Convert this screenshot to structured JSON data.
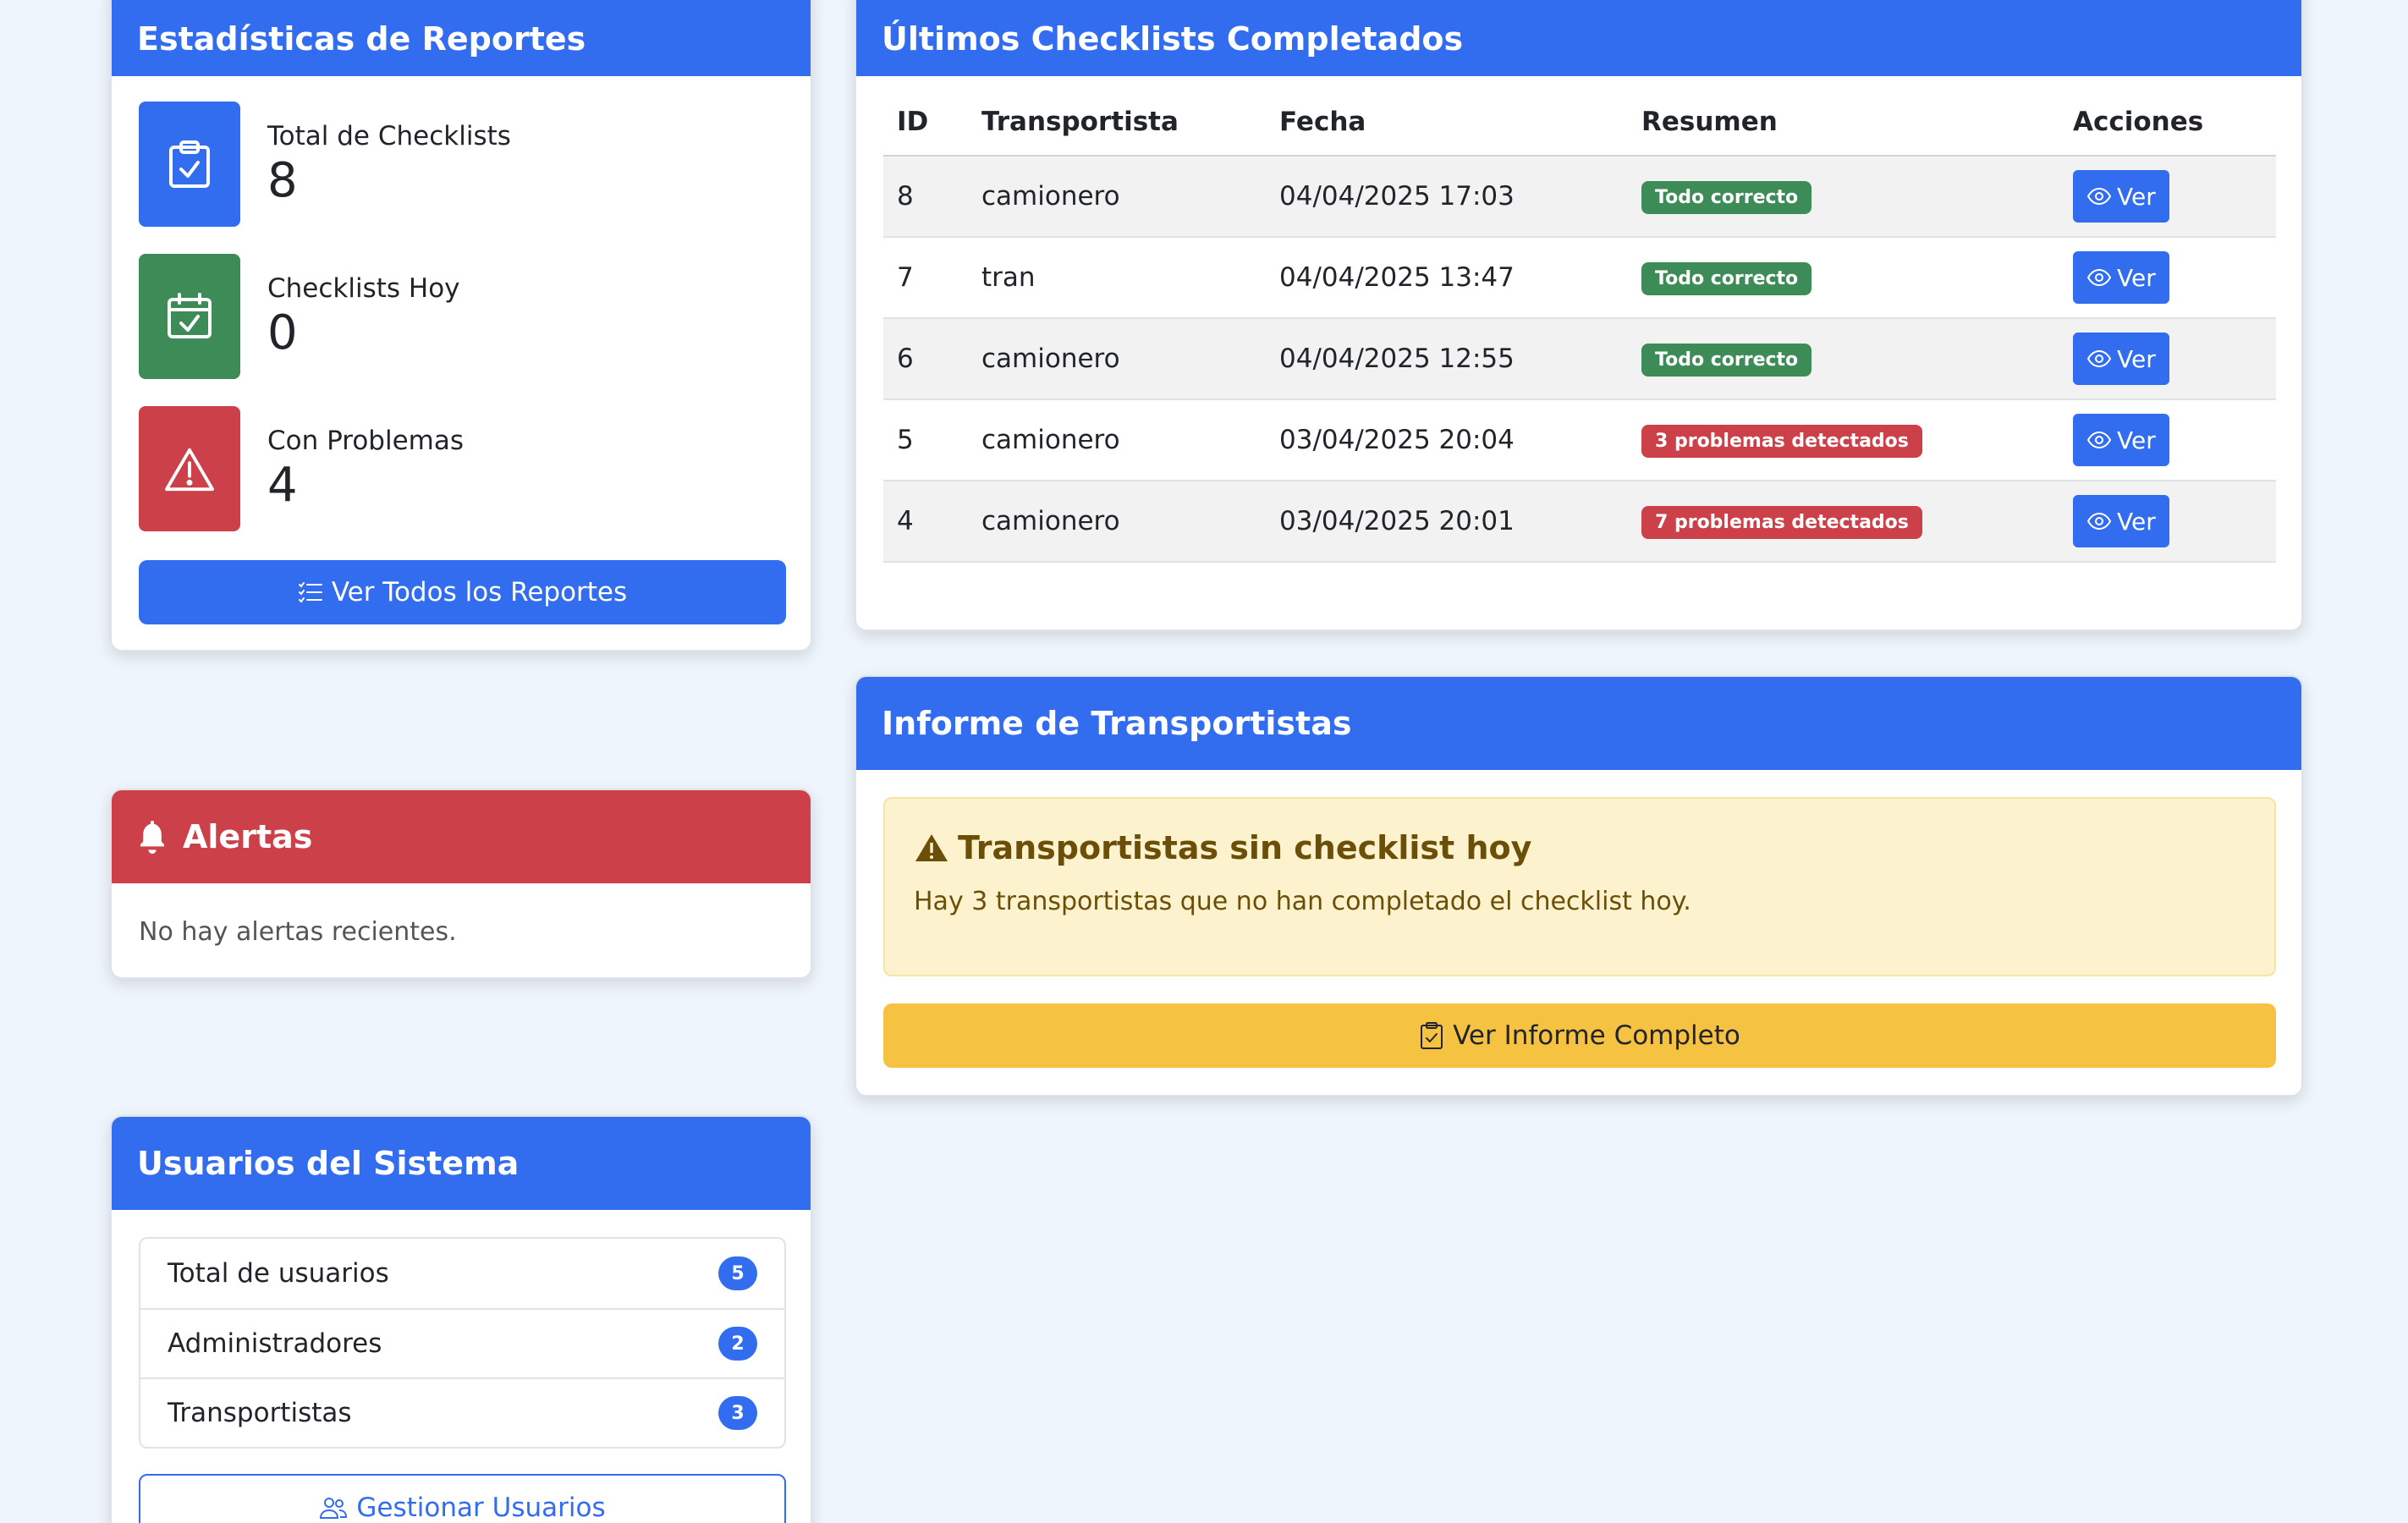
{
  "stats": {
    "title": "Estadísticas de Reportes",
    "items": [
      {
        "label": "Total de Checklists",
        "value": "8",
        "color": "#326cef",
        "icon": "clipboard-check-icon"
      },
      {
        "label": "Checklists Hoy",
        "value": "0",
        "color": "#3d8b57",
        "icon": "calendar-check-icon"
      },
      {
        "label": "Con Problemas",
        "value": "4",
        "color": "#cc404a",
        "icon": "warning-triangle-icon"
      }
    ],
    "button_label": "Ver Todos los Reportes"
  },
  "alerts": {
    "title": "Alertas",
    "empty_message": "No hay alertas recientes."
  },
  "users": {
    "title": "Usuarios del Sistema",
    "items": [
      {
        "label": "Total de usuarios",
        "count": "5"
      },
      {
        "label": "Administradores",
        "count": "2"
      },
      {
        "label": "Transportistas",
        "count": "3"
      }
    ],
    "button_label": "Gestionar Usuarios"
  },
  "recent": {
    "title": "Últimos Checklists Completados",
    "columns": [
      "ID",
      "Transportista",
      "Fecha",
      "Resumen",
      "Acciones"
    ],
    "rows": [
      {
        "id": "8",
        "carrier": "camionero",
        "date": "04/04/2025 17:03",
        "summary": "Todo correcto",
        "status": "ok",
        "action": "Ver"
      },
      {
        "id": "7",
        "carrier": "tran",
        "date": "04/04/2025 13:47",
        "summary": "Todo correcto",
        "status": "ok",
        "action": "Ver"
      },
      {
        "id": "6",
        "carrier": "camionero",
        "date": "04/04/2025 12:55",
        "summary": "Todo correcto",
        "status": "ok",
        "action": "Ver"
      },
      {
        "id": "5",
        "carrier": "camionero",
        "date": "03/04/2025 20:04",
        "summary": "3 problemas detectados",
        "status": "bad",
        "action": "Ver"
      },
      {
        "id": "4",
        "carrier": "camionero",
        "date": "03/04/2025 20:01",
        "summary": "7 problemas detectados",
        "status": "bad",
        "action": "Ver"
      }
    ]
  },
  "carriers": {
    "title": "Informe de Transportistas",
    "warning_title": "Transportistas sin checklist hoy",
    "warning_message": "Hay 3 transportistas que no han completado el checklist hoy.",
    "button_label": "Ver Informe Completo"
  },
  "colors": {
    "primary": "#326cef",
    "success": "#3d8b57",
    "danger": "#cc404a",
    "warning": "#f5c242",
    "page_background": "#eff5fd"
  }
}
